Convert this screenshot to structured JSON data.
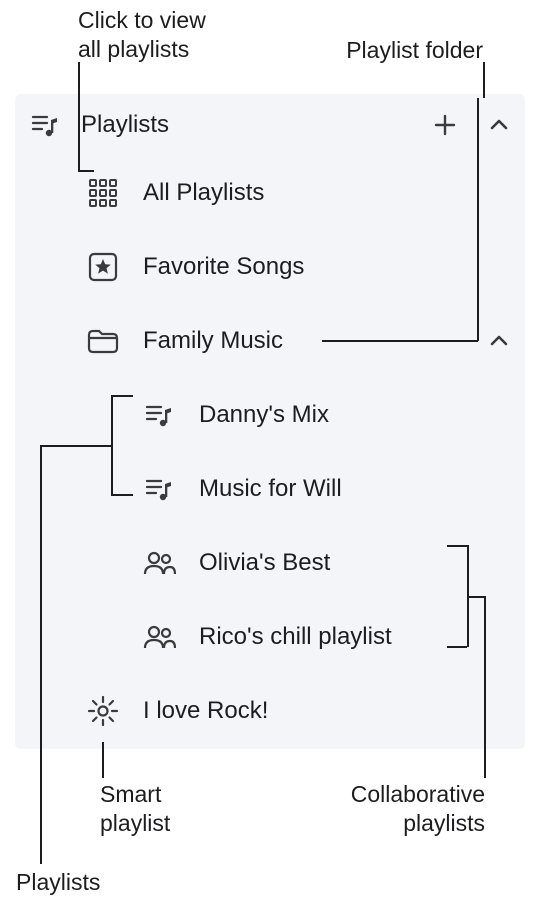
{
  "callouts": {
    "top_left_l1": "Click to view",
    "top_left_l2": "all playlists",
    "top_right": "Playlist folder",
    "smart_l1": "Smart",
    "smart_l2": "playlist",
    "collab_l1": "Collaborative",
    "collab_l2": "playlists",
    "bottom_left": "Playlists"
  },
  "header": {
    "label": "Playlists"
  },
  "items": {
    "all": "All Playlists",
    "fav": "Favorite Songs",
    "folder": "Family Music",
    "danny": "Danny's Mix",
    "will": "Music for Will",
    "olivia": "Olivia's Best",
    "rico": "Rico's chill playlist",
    "rock": "I love Rock!"
  },
  "colors": {
    "stroke": "#3b3b3d",
    "panel": "#f4f5f9"
  }
}
